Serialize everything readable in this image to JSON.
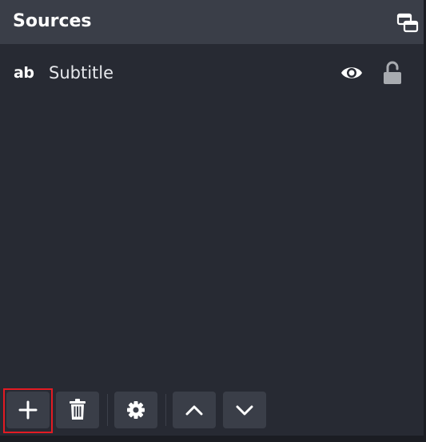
{
  "panel": {
    "title": "Sources"
  },
  "sources": [
    {
      "type_icon_label": "ab",
      "type_icon": "text-source-icon",
      "name": "Subtitle",
      "visible": true,
      "locked": false
    }
  ],
  "toolbar": {
    "buttons": [
      {
        "icon": "plus-icon",
        "action": "add-source",
        "highlighted": true
      },
      {
        "icon": "trash-icon",
        "action": "remove-source"
      },
      {
        "icon": "gear-icon",
        "action": "source-properties"
      },
      {
        "icon": "chevron-up-icon",
        "action": "move-source-up"
      },
      {
        "icon": "chevron-down-icon",
        "action": "move-source-down"
      }
    ]
  },
  "colors": {
    "panel_bg": "#272a33",
    "header_bg": "#3a3e48",
    "button_bg": "#3a3e48",
    "text": "#ffffff",
    "lock_icon": "#a8abb0",
    "highlight": "#e31b23"
  }
}
